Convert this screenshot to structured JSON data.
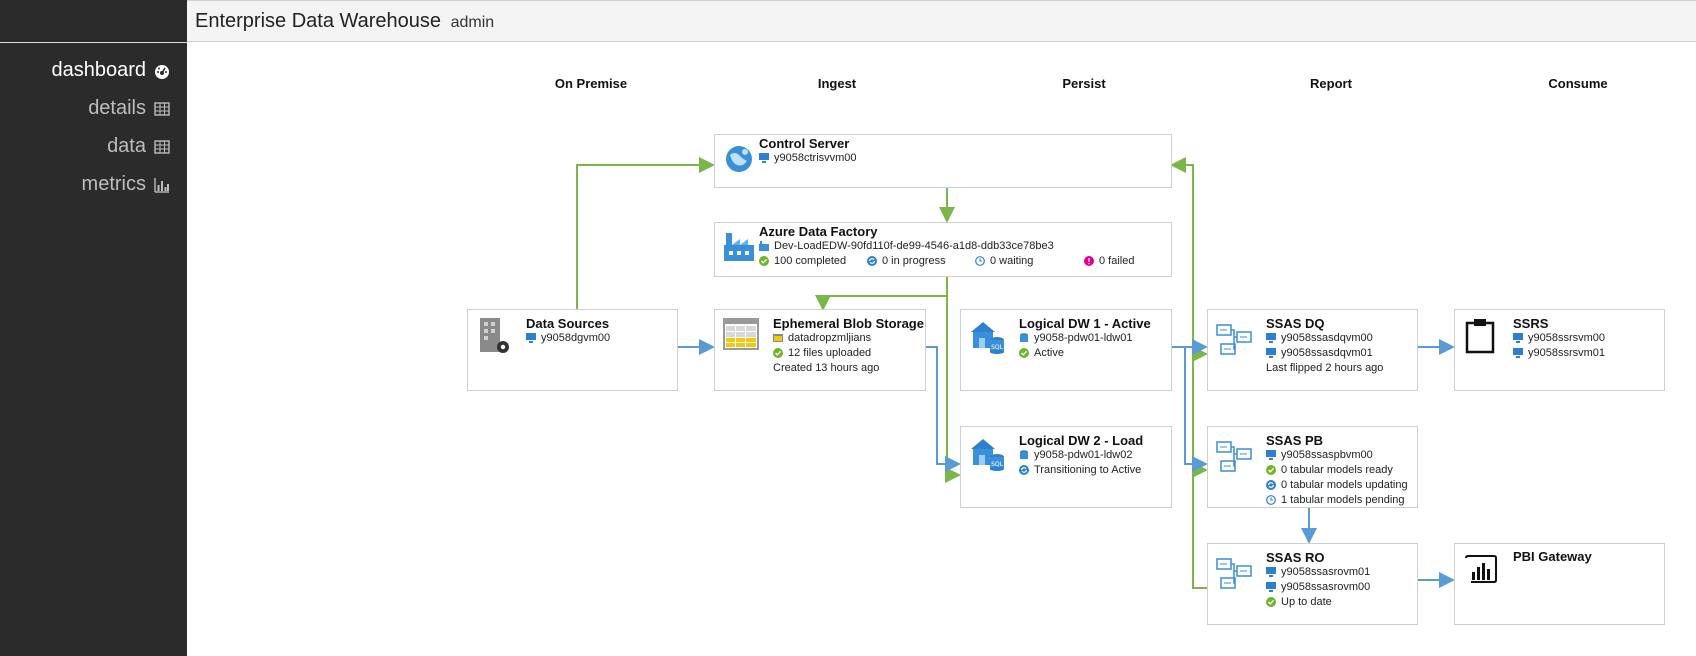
{
  "header": {
    "title": "Enterprise Data Warehouse",
    "user": "admin"
  },
  "sidebar": {
    "items": [
      {
        "label": "dashboard",
        "icon": "dashboard-icon",
        "active": true
      },
      {
        "label": "details",
        "icon": "table-icon"
      },
      {
        "label": "data",
        "icon": "table-icon"
      },
      {
        "label": "metrics",
        "icon": "bar-chart-icon"
      }
    ]
  },
  "columns": [
    "On Premise",
    "Ingest",
    "Persist",
    "Report",
    "Consume"
  ],
  "nodes": {
    "control_server": {
      "title": "Control Server",
      "vm": "y9058ctrisvvm00"
    },
    "adf": {
      "title": "Azure Data Factory",
      "pipeline": "Dev-LoadEDW-90fd110f-de99-4546-a1d8-ddb33ce78be3",
      "completed": "100 completed",
      "in_progress": "0 in progress",
      "waiting": "0 waiting",
      "failed": "0 failed"
    },
    "data_sources": {
      "title": "Data Sources",
      "vm": "y9058dgvm00"
    },
    "blob": {
      "title": "Ephemeral Blob Storage",
      "container": "datadropzmljians",
      "uploaded": "12 files uploaded",
      "created": "Created 13 hours ago"
    },
    "ldw1": {
      "title": "Logical DW 1 - Active",
      "db": "y9058-pdw01-ldw01",
      "status": "Active"
    },
    "ldw2": {
      "title": "Logical DW 2 - Load",
      "db": "y9058-pdw01-ldw02",
      "status": "Transitioning to Active"
    },
    "ssas_dq": {
      "title": "SSAS DQ",
      "vm1": "y9058ssasdqvm00",
      "vm2": "y9058ssasdqvm01",
      "note": "Last flipped 2 hours ago"
    },
    "ssas_pb": {
      "title": "SSAS PB",
      "vm": "y9058ssaspbvm00",
      "ready": "0 tabular models ready",
      "updating": "0 tabular models updating",
      "pending": "1 tabular models pending"
    },
    "ssas_ro": {
      "title": "SSAS RO",
      "vm1": "y9058ssasrovm01",
      "vm2": "y9058ssasrovm00",
      "status": "Up to date"
    },
    "ssrs": {
      "title": "SSRS",
      "vm1": "y9058ssrsvm00",
      "vm2": "y9058ssrsvm01"
    },
    "pbi": {
      "title": "PBI Gateway"
    }
  },
  "colors": {
    "green": "#7ab648",
    "blue": "#5b9bd5",
    "sidebar": "#2b2b2b",
    "ok": "#6fb42c",
    "progress": "#2f7fd0",
    "failed": "#e3008c"
  }
}
